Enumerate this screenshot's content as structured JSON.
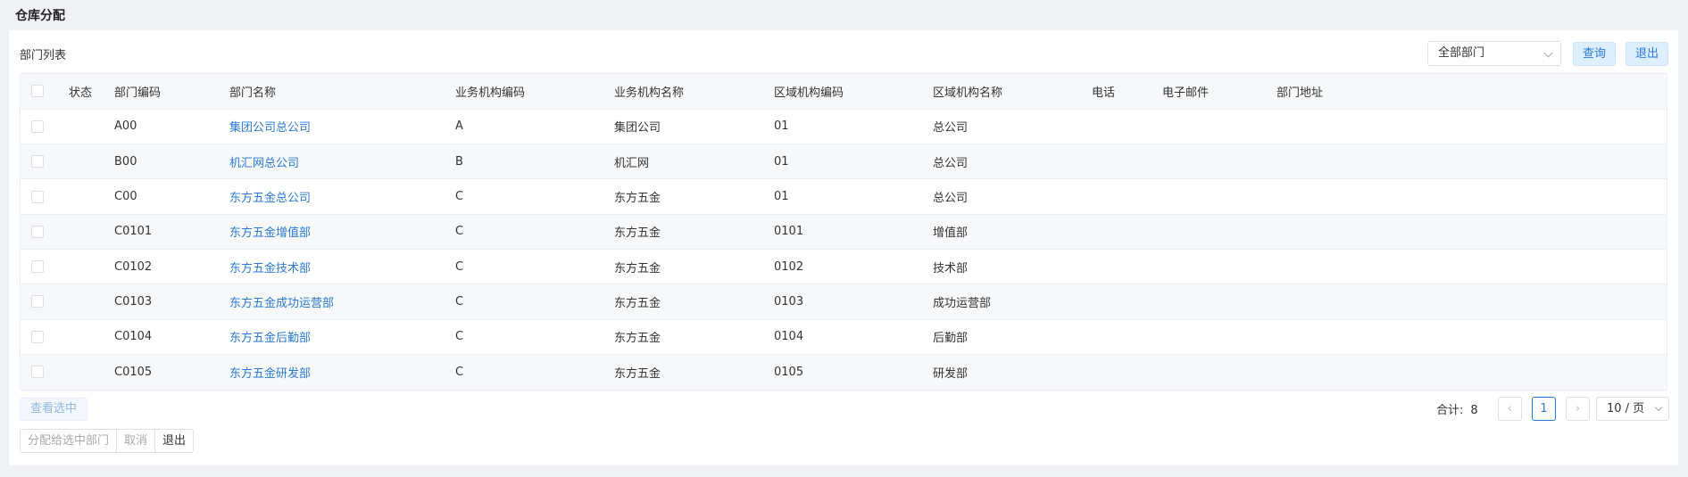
{
  "page": {
    "title": "仓库分配"
  },
  "panel": {
    "label": "部门列表",
    "dept_select": "全部部门",
    "query_button": "查询",
    "exit_button": "退出"
  },
  "table": {
    "columns": [
      "",
      "状态",
      "部门编码",
      "部门名称",
      "业务机构编码",
      "业务机构名称",
      "区域机构编码",
      "区域机构名称",
      "电话",
      "电子邮件",
      "部门地址"
    ],
    "rows": [
      {
        "status": "",
        "code": "A00",
        "name": "集团公司总公司",
        "biz_code": "A",
        "biz_name": "集团公司",
        "region_code": "01",
        "region_name": "总公司",
        "phone": "",
        "email": "",
        "address": ""
      },
      {
        "status": "",
        "code": "B00",
        "name": "机汇网总公司",
        "biz_code": "B",
        "biz_name": "机汇网",
        "region_code": "01",
        "region_name": "总公司",
        "phone": "",
        "email": "",
        "address": ""
      },
      {
        "status": "",
        "code": "C00",
        "name": "东方五金总公司",
        "biz_code": "C",
        "biz_name": "东方五金",
        "region_code": "01",
        "region_name": "总公司",
        "phone": "",
        "email": "",
        "address": ""
      },
      {
        "status": "",
        "code": "C0101",
        "name": "东方五金增值部",
        "biz_code": "C",
        "biz_name": "东方五金",
        "region_code": "0101",
        "region_name": "增值部",
        "phone": "",
        "email": "",
        "address": ""
      },
      {
        "status": "",
        "code": "C0102",
        "name": "东方五金技术部",
        "biz_code": "C",
        "biz_name": "东方五金",
        "region_code": "0102",
        "region_name": "技术部",
        "phone": "",
        "email": "",
        "address": ""
      },
      {
        "status": "",
        "code": "C0103",
        "name": "东方五金成功运营部",
        "biz_code": "C",
        "biz_name": "东方五金",
        "region_code": "0103",
        "region_name": "成功运营部",
        "phone": "",
        "email": "",
        "address": ""
      },
      {
        "status": "",
        "code": "C0104",
        "name": "东方五金后勤部",
        "biz_code": "C",
        "biz_name": "东方五金",
        "region_code": "0104",
        "region_name": "后勤部",
        "phone": "",
        "email": "",
        "address": ""
      },
      {
        "status": "",
        "code": "C0105",
        "name": "东方五金研发部",
        "biz_code": "C",
        "biz_name": "东方五金",
        "region_code": "0105",
        "region_name": "研发部",
        "phone": "",
        "email": "",
        "address": ""
      }
    ]
  },
  "footer": {
    "view_selected": "查看选中",
    "assign_button": "分配给选中部门",
    "cancel_button": "取消",
    "exit_button": "退出"
  },
  "pagination": {
    "total_label": "合计:",
    "total": "8",
    "prev_icon": "chevron-left-icon",
    "next_icon": "chevron-right-icon",
    "prev_glyph": "‹",
    "next_glyph": "›",
    "current_page": "1",
    "page_size": "10 / 页"
  },
  "colors": {
    "accent": "#2a7ad6",
    "background": "#f0f1f5"
  }
}
